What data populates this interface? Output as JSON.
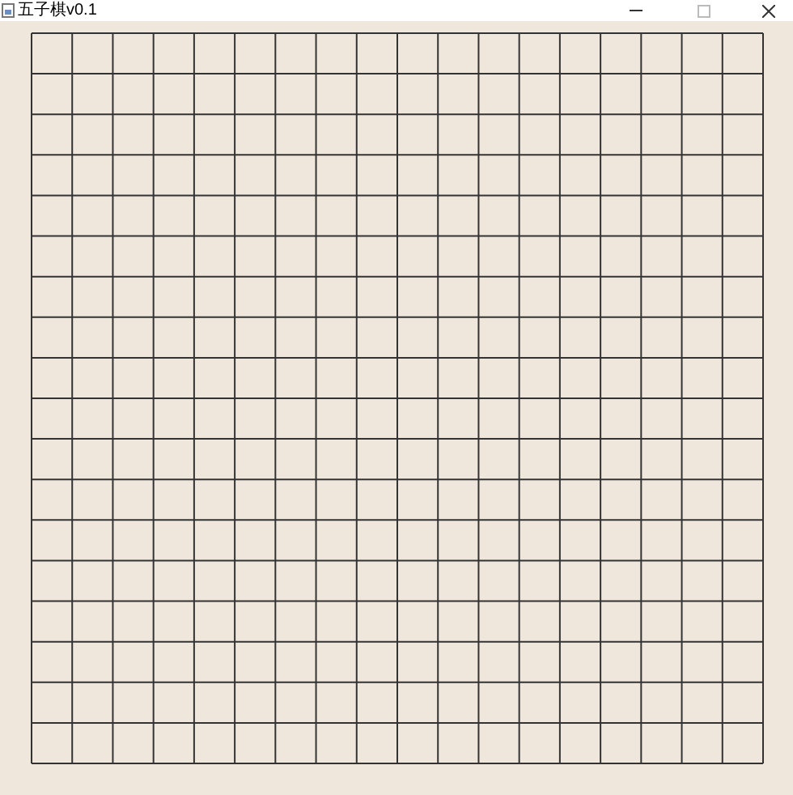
{
  "window": {
    "title": "五子棋v0.1"
  }
}
